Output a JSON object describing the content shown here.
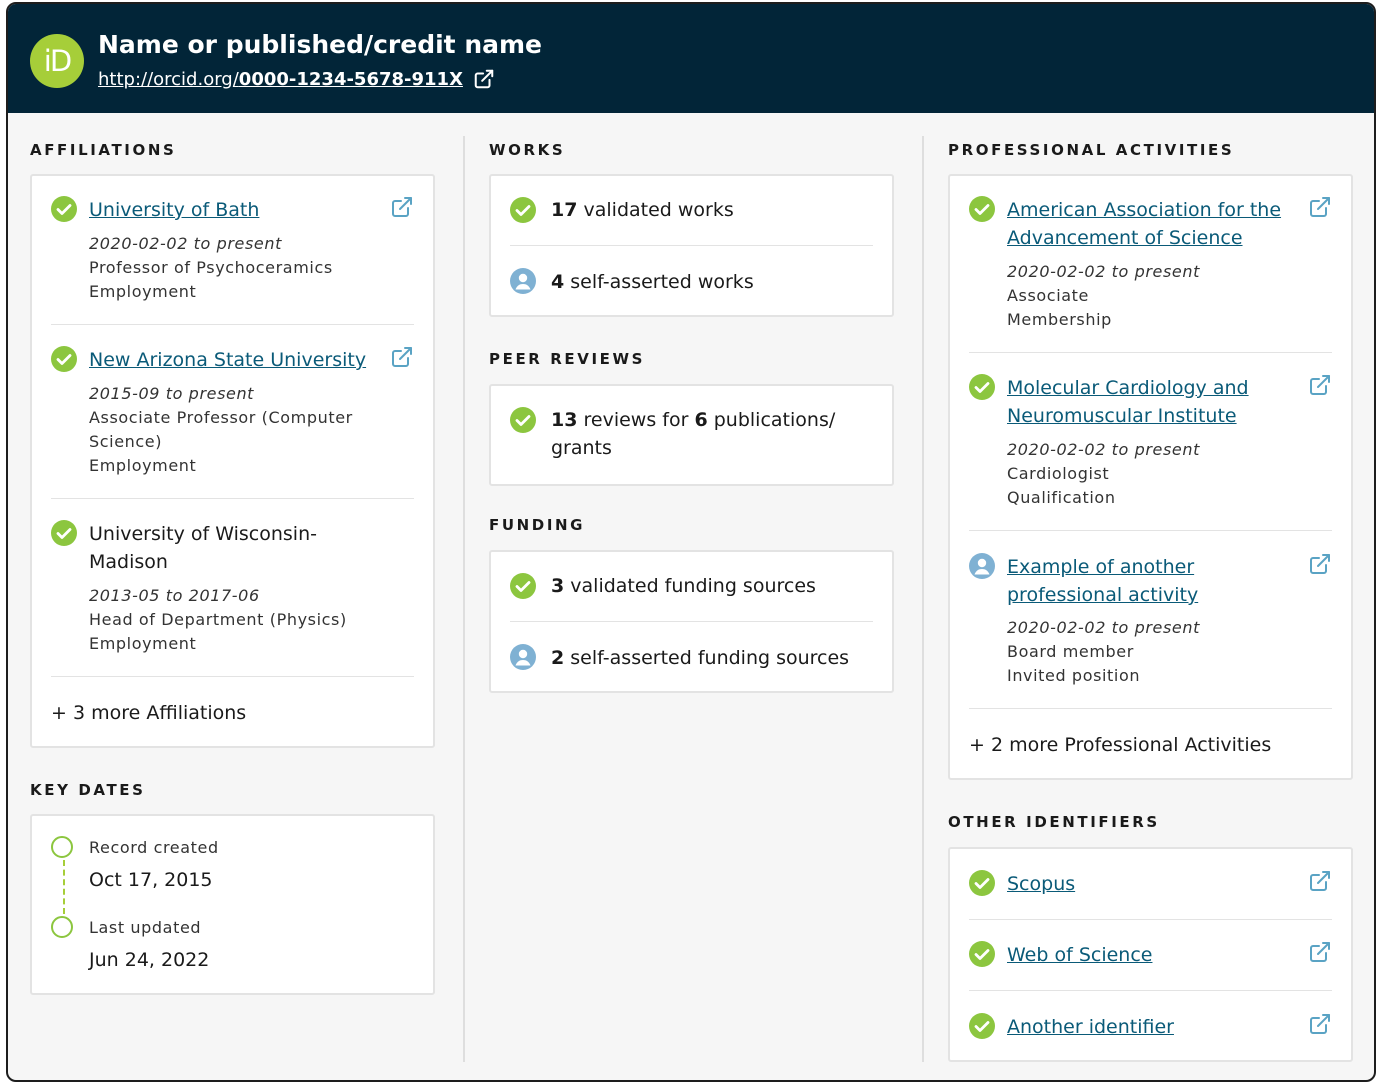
{
  "header": {
    "name": "Name or published/credit name",
    "logo_text": "iD",
    "url_prefix": "http://orcid.org/",
    "orcid_id": "0000-1234-5678-911X"
  },
  "affiliations": {
    "title": "AFFILIATIONS",
    "items": [
      {
        "name": "University of Bath",
        "linked": true,
        "dates": "2020-02-02 to present",
        "role": "Professor of Psychoceramics",
        "type": "Employment"
      },
      {
        "name": "New Arizona State University",
        "linked": true,
        "dates": "2015-09 to present",
        "role": "Associate Professor (Computer Science)",
        "type": "Employment"
      },
      {
        "name": "University of Wisconsin-Madison",
        "linked": false,
        "dates": "2013-05 to 2017-06",
        "role": "Head of Department (Physics)",
        "type": "Employment"
      }
    ],
    "more": "+ 3 more Affiliations"
  },
  "key_dates": {
    "title": "KEY DATES",
    "created_label": "Record created",
    "created_value": "Oct 17, 2015",
    "updated_label": "Last updated",
    "updated_value": "Jun 24, 2022"
  },
  "works": {
    "title": "WORKS",
    "validated_count": "17",
    "validated_label": "validated works",
    "self_count": "4",
    "self_label": "self-asserted works"
  },
  "peer_reviews": {
    "title": "PEER REVIEWS",
    "reviews_count": "13",
    "reviews_text": "reviews for",
    "pubs_count": "6",
    "pubs_text": "publications/ grants"
  },
  "funding": {
    "title": "FUNDING",
    "validated_count": "3",
    "validated_label": "validated funding sources",
    "self_count": "2",
    "self_label": "self-asserted funding sources"
  },
  "professional_activities": {
    "title": "PROFESSIONAL ACTIVITIES",
    "items": [
      {
        "name": "American Association for the Advancement of Science",
        "status": "validated",
        "dates": "2020-02-02 to present",
        "role": "Associate",
        "type": "Membership"
      },
      {
        "name": "Molecular Cardiology and Neuromuscular Institute",
        "status": "validated",
        "dates": "2020-02-02 to present",
        "role": "Cardiologist",
        "type": "Qualification"
      },
      {
        "name": "Example of another professional activity",
        "status": "self-asserted",
        "dates": "2020-02-02 to present",
        "role": "Board member",
        "type": "Invited position"
      }
    ],
    "more": "+ 2 more Professional Activities"
  },
  "other_identifiers": {
    "title": "OTHER IDENTIFIERS",
    "items": [
      {
        "name": "Scopus"
      },
      {
        "name": "Web of Science"
      },
      {
        "name": "Another identifier"
      }
    ]
  },
  "colors": {
    "header_bg": "#022538",
    "orcid_green": "#a6ce39",
    "link": "#0a5a78",
    "self_asserted_blue": "#7fb1d3",
    "external_icon": "#5aa3c4"
  },
  "icons": {
    "validated": "check-circle-icon",
    "self_asserted": "person-circle-icon",
    "external": "external-link-icon"
  }
}
